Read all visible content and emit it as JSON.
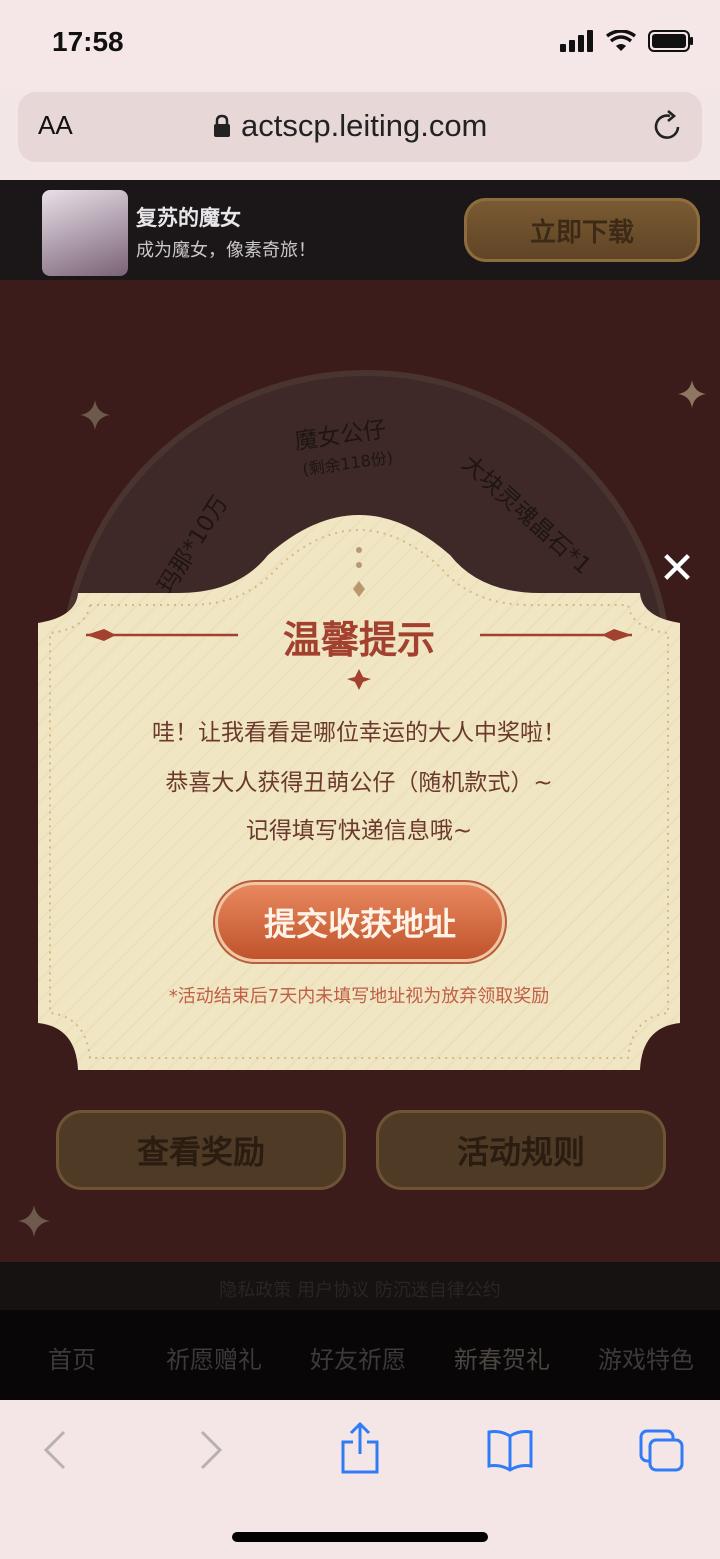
{
  "status": {
    "time": "17:58"
  },
  "browser": {
    "text_size_label": "AA",
    "url": "actscp.leiting.com"
  },
  "banner": {
    "title": "复苏的魔女",
    "subtitle": "成为魔女，像素奇旅！",
    "download_label": "立即下载"
  },
  "wheel": {
    "prize_top": "魔女公仔",
    "prize_top_remaining": "(剩余118份)",
    "prize_left": "玛那*10万",
    "prize_right": "大块灵魂晶石*1"
  },
  "page_buttons": {
    "rewards": "查看奖励",
    "rules": "活动规则"
  },
  "footer": {
    "links": "隐私政策 用户协议 防沉迷自律公约"
  },
  "bottom_nav": {
    "items": [
      "首页",
      "祈愿赠礼",
      "好友祈愿",
      "新春贺礼",
      "游戏特色"
    ]
  },
  "modal": {
    "title": "温馨提示",
    "line1": "哇！让我看看是哪位幸运的大人中奖啦！",
    "line2": "恭喜大人获得丑萌公仔（随机款式）~",
    "line3": "记得填写快递信息哦~",
    "submit_label": "提交收获地址",
    "note": "*活动结束后7天内未填写地址视为放弃领取奖励",
    "close_label": "✕"
  },
  "colors": {
    "accent": "#a2412f",
    "button": "#c9603a",
    "modal_bg": "#f2e7c4"
  }
}
